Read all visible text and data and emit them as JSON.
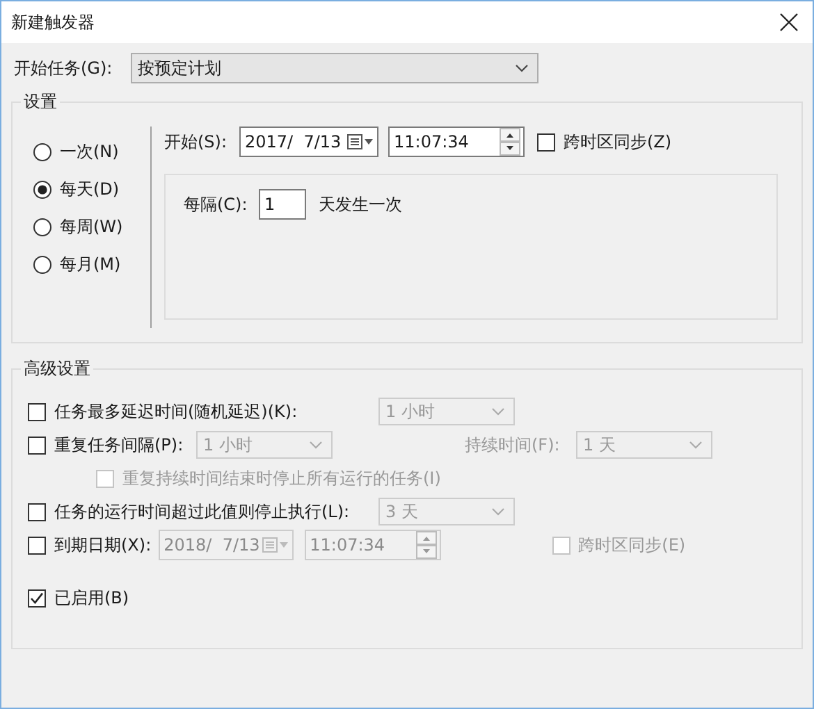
{
  "window": {
    "title": "新建触发器"
  },
  "start_task": {
    "label": "开始任务(G):",
    "value": "按预定计划"
  },
  "settings": {
    "title": "设置",
    "schedule_options": [
      {
        "label": "一次(N)",
        "selected": false
      },
      {
        "label": "每天(D)",
        "selected": true
      },
      {
        "label": "每周(W)",
        "selected": false
      },
      {
        "label": "每月(M)",
        "selected": false
      }
    ],
    "start": {
      "label": "开始(S):",
      "date": "2017/  7/13",
      "time": "11:07:34",
      "sync_timezone": {
        "label": "跨时区同步(Z)",
        "checked": false
      }
    },
    "recur": {
      "label": "每隔(C):",
      "value": "1",
      "unit": "天发生一次"
    }
  },
  "advanced": {
    "title": "高级设置",
    "delay": {
      "label": "任务最多延迟时间(随机延迟)(K):",
      "checked": false,
      "value": "1 小时"
    },
    "repeat": {
      "label": "重复任务间隔(P):",
      "checked": false,
      "value": "1 小时",
      "duration_label": "持续时间(F):",
      "duration": "1 天"
    },
    "repeat_stop": {
      "label": "重复持续时间结束时停止所有运行的任务(I)",
      "checked": false
    },
    "stop_after": {
      "label": "任务的运行时间超过此值则停止执行(L):",
      "checked": false,
      "value": "3 天"
    },
    "expiry": {
      "label": "到期日期(X):",
      "checked": false,
      "date": "2018/  7/13",
      "time": "11:07:34",
      "sync_timezone": {
        "label": "跨时区同步(E)",
        "checked": false
      }
    }
  },
  "enabled": {
    "label": "已启用(B)",
    "checked": true
  }
}
